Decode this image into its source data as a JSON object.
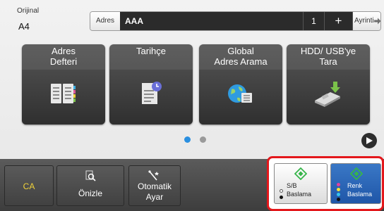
{
  "header": {
    "original_title": "Orijinal",
    "original_value": "A4",
    "address_label": "Adres",
    "address_value": "AAA",
    "address_count": "1",
    "add_symbol": "+",
    "detail_label": "Ayrinti"
  },
  "tiles": [
    {
      "label": "Adres\nDefteri",
      "icon": "address-book-icon"
    },
    {
      "label": "Tarihçe",
      "icon": "history-document-icon"
    },
    {
      "label": "Global\nAdres Arama",
      "icon": "globe-address-search-icon"
    },
    {
      "label": "HDD/ USB'ye\nTara",
      "icon": "hdd-usb-scan-icon"
    }
  ],
  "pager": {
    "active_index": 0,
    "total": 2
  },
  "bottom": {
    "ca_label": "CA",
    "preview_label": "Önizle",
    "auto_label": "Otomatik\nAyar",
    "bw_start_label": "S/B\nBaslama",
    "color_start_label": "Renk\nBaslama"
  },
  "colors": {
    "accent_blue": "#2a8fe0",
    "highlight_red": "#e3171b",
    "ca_yellow": "#f0d23a",
    "start_green": "#36b54a"
  }
}
